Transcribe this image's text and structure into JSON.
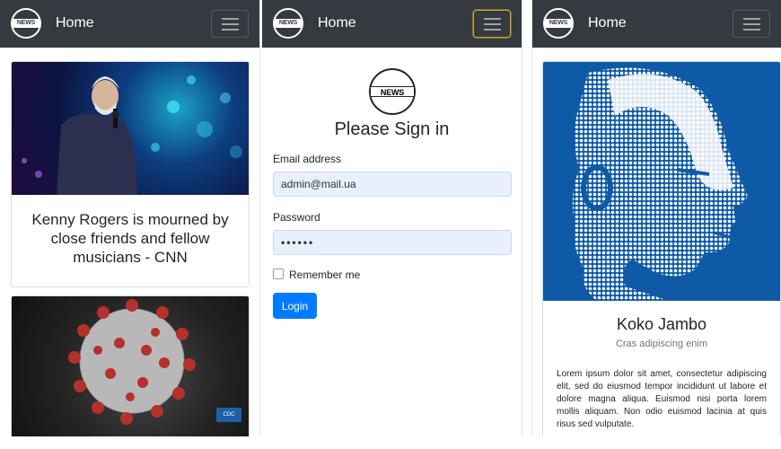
{
  "brand_logo": "NEWS",
  "screens": [
    {
      "nav": {
        "title": "Home"
      },
      "cards": [
        {
          "title": "Kenny Rogers is mourned by close friends and fellow musicians - CNN",
          "image": "concert-photo"
        },
        {
          "title": "",
          "image": "coronavirus-illustration",
          "badge": "CDC"
        }
      ]
    },
    {
      "nav": {
        "title": "Home"
      },
      "login": {
        "heading": "Please Sign in",
        "email_label": "Email address",
        "email_value": "admin@mail.ua",
        "password_label": "Password",
        "password_value": "••••••",
        "remember_label": "Remember me",
        "submit_label": "Login"
      }
    },
    {
      "nav": {
        "title": "Home"
      },
      "profile": {
        "name": "Koko Jambo",
        "subtitle": "Cras adipiscing enim",
        "text": "Lorem ipsum dolor sit amet, consectetur adipiscing elit, sed do eiusmod tempor incididunt ut labore et dolore magna aliqua. Euismod nisi porta lorem mollis aliquam. Non odio euismod lacinia at quis risus sed vulputate."
      }
    }
  ],
  "colors": {
    "navbar": "#343a40",
    "primary": "#007bff",
    "portrait_bg": "#0e5aa7"
  }
}
